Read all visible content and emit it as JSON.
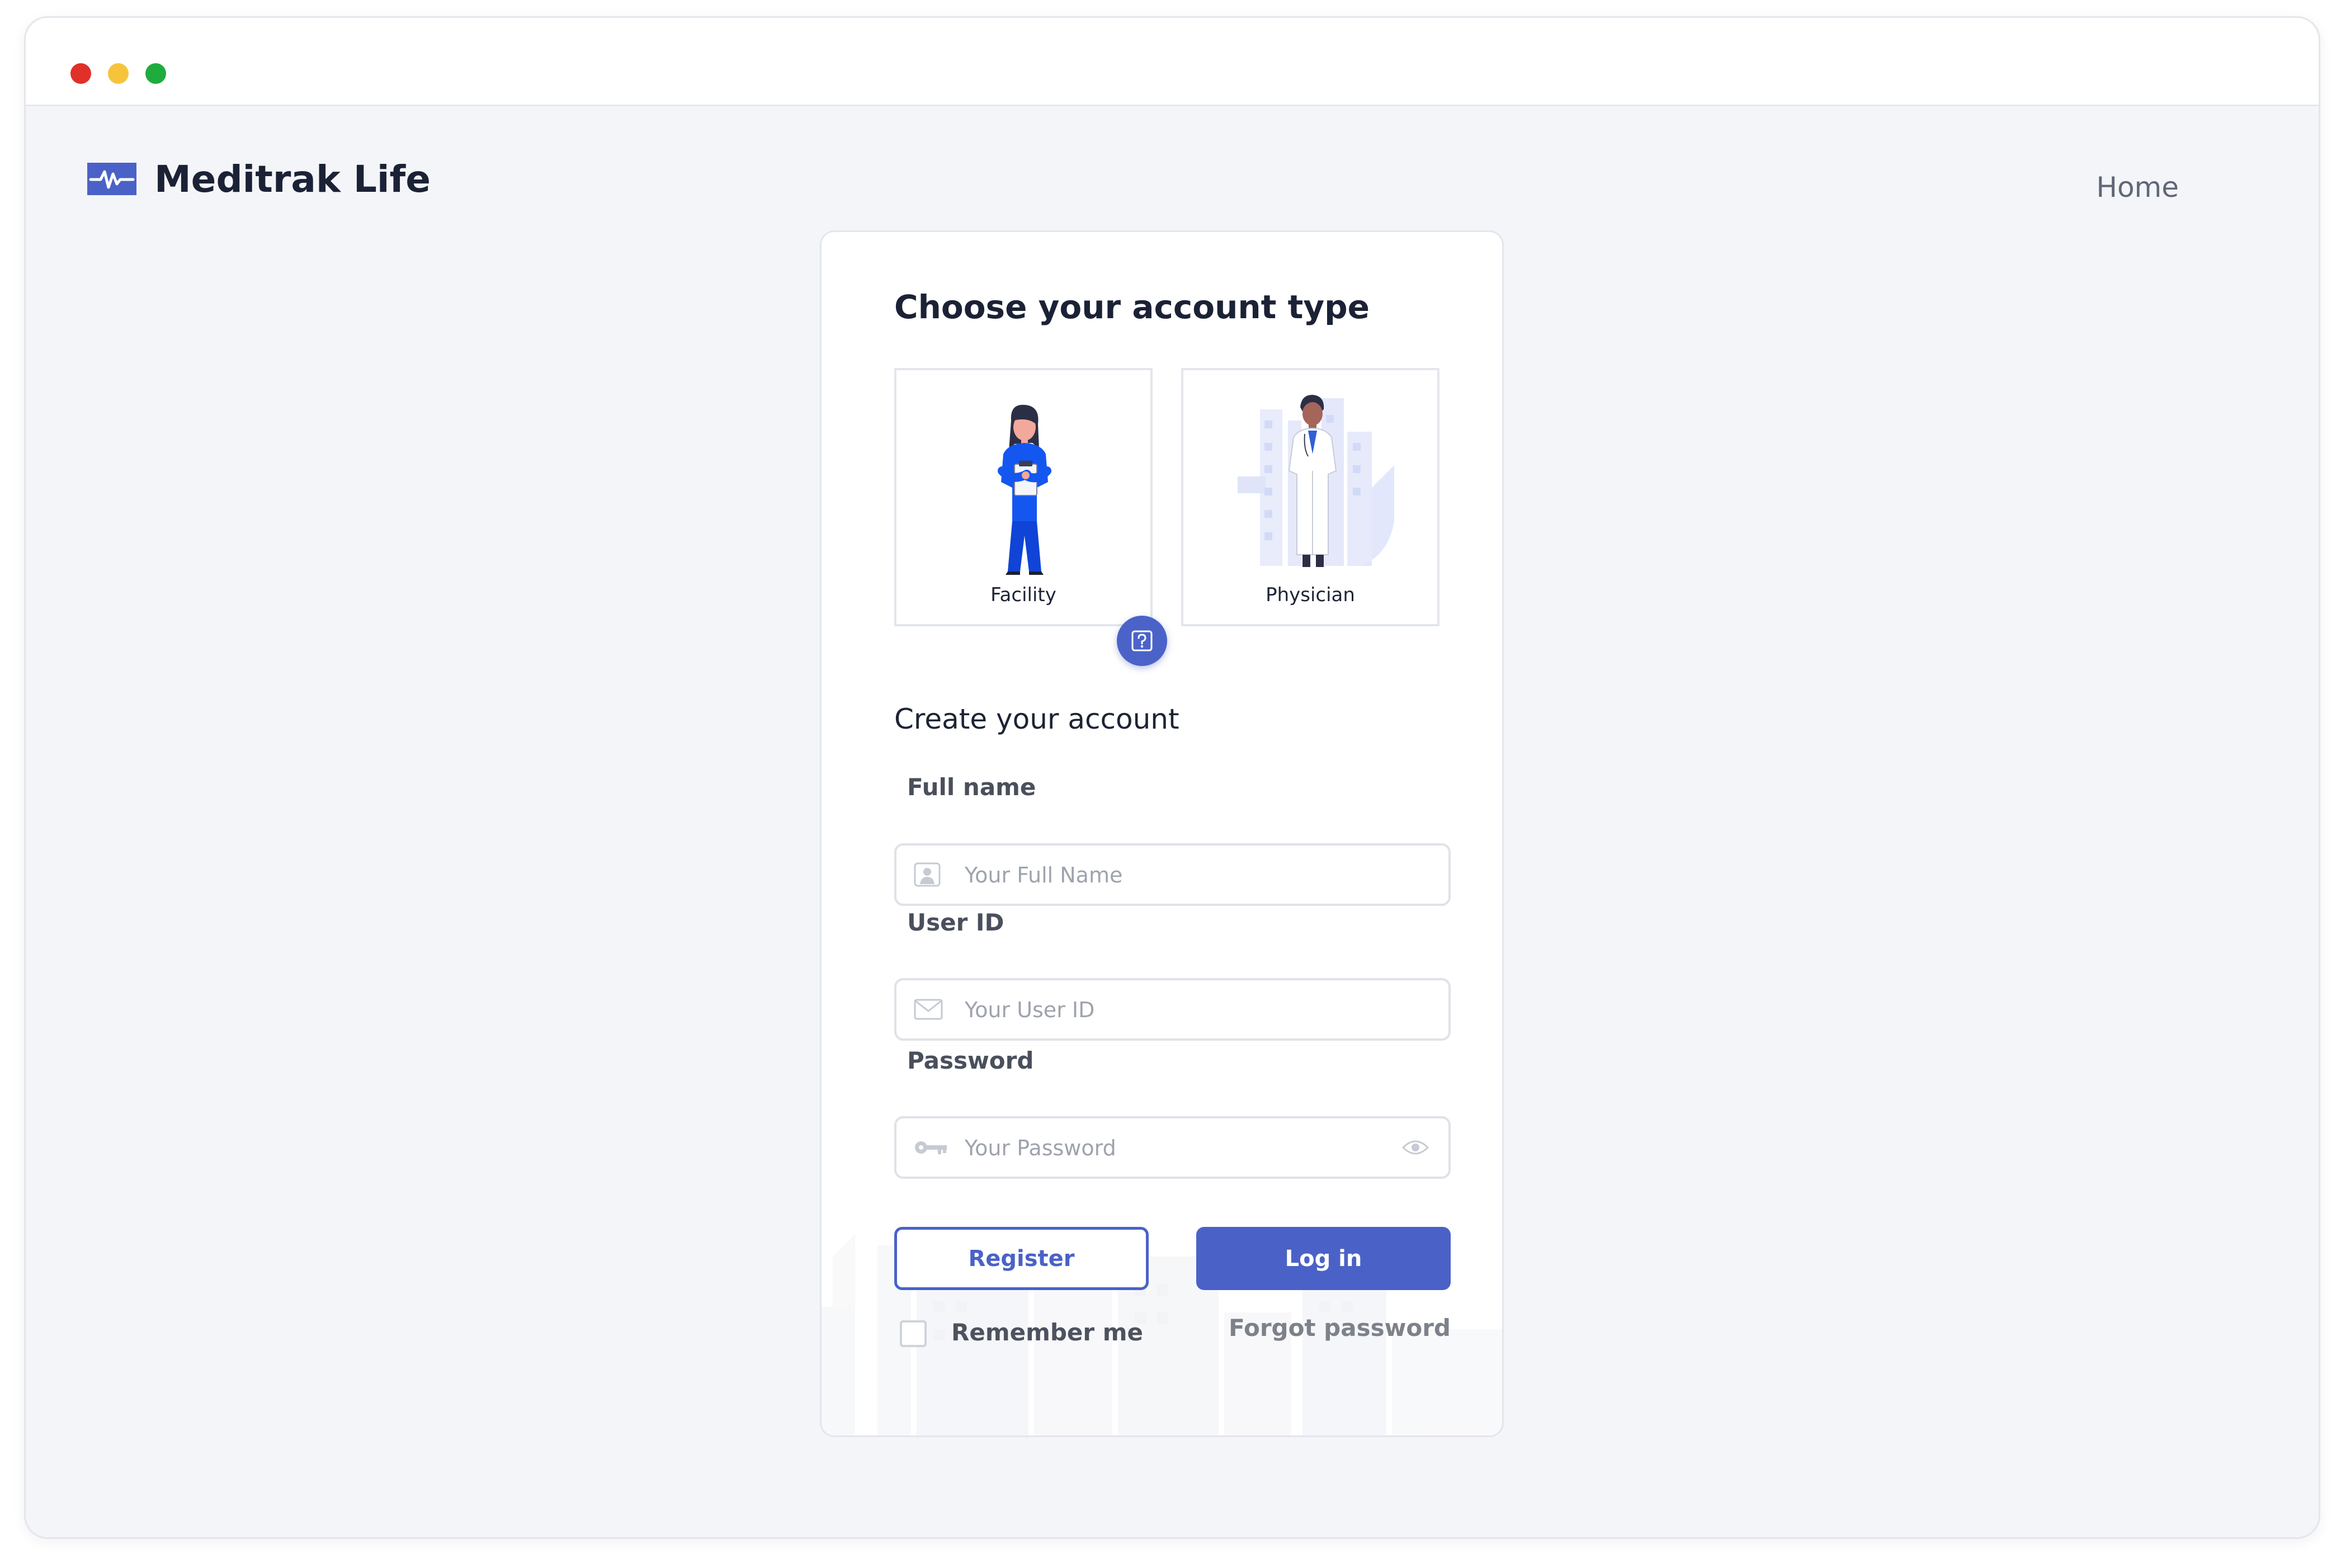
{
  "window": {
    "controls": [
      "close",
      "minimize",
      "maximize"
    ],
    "colors": {
      "close": "#e0302a",
      "minimize": "#f6c43c",
      "maximize": "#1fac3f"
    }
  },
  "header": {
    "brand_name": "Meditrak Life",
    "logo_icon": "heartbeat-pulse-icon",
    "nav": {
      "home": "Home"
    }
  },
  "card": {
    "title": "Choose your account type",
    "account_types": [
      {
        "label": "Facility",
        "illustration": "nurse-with-clipboard"
      },
      {
        "label": "Physician",
        "illustration": "doctor-with-city-background"
      }
    ],
    "help_icon": "question-badge-icon",
    "form_title": "Create your account",
    "fields": {
      "full_name": {
        "label": "Full name",
        "placeholder": "Your Full Name",
        "icon": "user-icon"
      },
      "user_id": {
        "label": "User ID",
        "placeholder": "Your User ID",
        "icon": "envelope-icon"
      },
      "password": {
        "label": "Password",
        "placeholder": "Your Password",
        "icon": "key-icon",
        "toggle_icon": "eye-icon"
      }
    },
    "buttons": {
      "register": "Register",
      "login": "Log in"
    },
    "remember_me": "Remember me",
    "forgot_password": "Forgot password"
  },
  "colors": {
    "accent": "#4a62c7",
    "background": "#f4f5f9",
    "card": "#ffffff",
    "title": "#1b2236"
  }
}
